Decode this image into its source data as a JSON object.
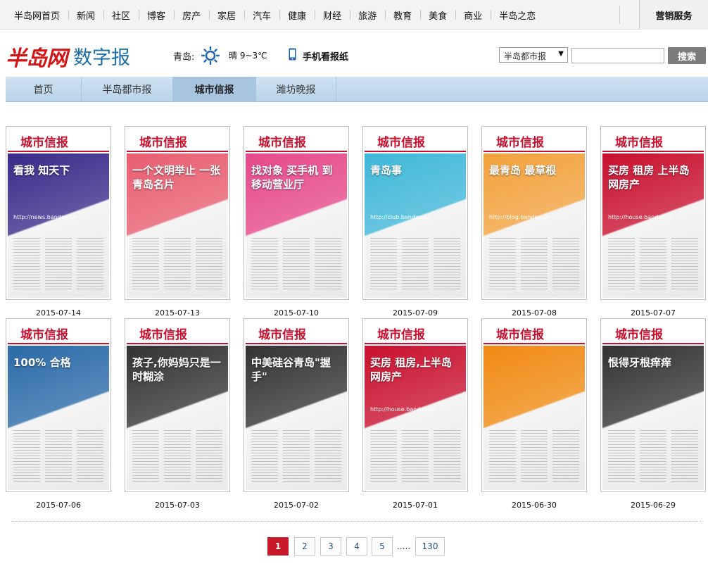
{
  "top_nav": {
    "items": [
      "半岛网首页",
      "新闻",
      "社区",
      "博客",
      "房产",
      "家居",
      "汽车",
      "健康",
      "财经",
      "旅游",
      "教育",
      "美食",
      "商业",
      "半岛之恋"
    ],
    "service": "营销服务"
  },
  "brand": {
    "logo": "半岛网",
    "subtitle": "数字报",
    "city": "青岛:",
    "weather_icon": "sun-icon",
    "weather": "晴 9~3℃",
    "mobile_label": "手机看报纸"
  },
  "search": {
    "select_value": "半岛都市报",
    "input_value": "",
    "button_label": "搜索"
  },
  "tabs": [
    {
      "label": "首页",
      "active": false
    },
    {
      "label": "半岛都市报",
      "active": false
    },
    {
      "label": "城市信报",
      "active": true
    },
    {
      "label": "潍坊晚报",
      "active": false
    }
  ],
  "colors": {
    "brand_red": "#c8102e",
    "tab_active": "#a7c5e0",
    "tab_bar": "#c4dbee"
  },
  "issues": [
    {
      "date": "2015-07-14",
      "masthead": "城市信报",
      "headline": "看我 知天下",
      "url": "http://news.bandao.cn",
      "theme": "#3a2a8a"
    },
    {
      "date": "2015-07-13",
      "masthead": "城市信报",
      "headline": "一个文明举止 一张青岛名片",
      "theme": "#e85d6f"
    },
    {
      "date": "2015-07-10",
      "masthead": "城市信报",
      "headline": "找对象 买手机 到移动营业厅",
      "theme": "#e6488a"
    },
    {
      "date": "2015-07-09",
      "masthead": "城市信报",
      "headline": "青岛事",
      "url": "http://club.bandao.cn",
      "theme": "#3fb7d8"
    },
    {
      "date": "2015-07-08",
      "masthead": "城市信报",
      "headline": "最青岛 最草根",
      "url": "http://blog.bandao.cn",
      "theme": "#f2a13c"
    },
    {
      "date": "2015-07-07",
      "masthead": "城市信报",
      "headline": "买房 租房 上半岛网房产",
      "url": "http://house.bandao.cn",
      "theme": "#c8102e"
    },
    {
      "date": "2015-07-06",
      "masthead": "城市信报",
      "headline": "100% 合格",
      "theme": "#2a6aa8"
    },
    {
      "date": "2015-07-03",
      "masthead": "城市信报",
      "headline": "孩子,你妈妈只是一时糊涂",
      "theme": "#333333"
    },
    {
      "date": "2015-07-02",
      "masthead": "城市信报",
      "headline": "中美硅谷青岛\"握手\"",
      "theme": "#333333"
    },
    {
      "date": "2015-07-01",
      "masthead": "城市信报",
      "headline": "买房 租房,上半岛网房产",
      "url": "http://house.bandao.cn",
      "theme": "#c8102e"
    },
    {
      "date": "2015-06-30",
      "masthead": "城市信报",
      "headline": "",
      "theme": "#f08a12"
    },
    {
      "date": "2015-06-29",
      "masthead": "城市信报",
      "headline": "恨得牙根痒痒",
      "theme": "#333333"
    }
  ],
  "pagination": {
    "pages": [
      "1",
      "2",
      "3",
      "4",
      "5"
    ],
    "current": "1",
    "ellipsis": ".....",
    "last": "130"
  }
}
